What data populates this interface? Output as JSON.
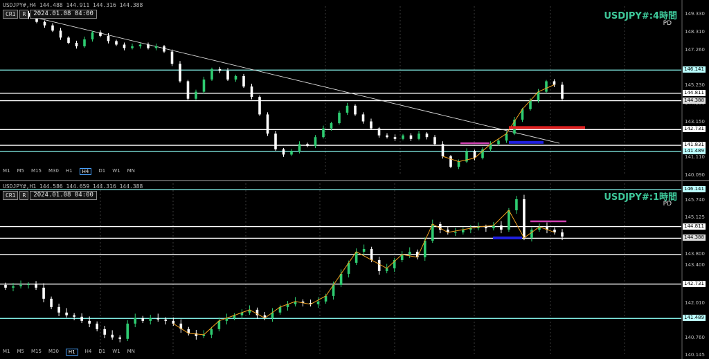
{
  "panes": [
    {
      "symbol_line": "USDJPY#,H4  144.488 144.911 144.316 144.388",
      "controls": {
        "cr": "CR1",
        "r": "R",
        "date": "2024.01.08 04:00"
      },
      "title": "USDJPY#:4時間",
      "subtitle": "PD",
      "timeframes": [
        "M1",
        "M5",
        "M15",
        "M30",
        "H1",
        "H4",
        "D1",
        "W1",
        "MN"
      ],
      "active_timeframe": "H4",
      "axis": {
        "min": 140.09,
        "max": 149.6,
        "ticks": [
          149.33,
          148.31,
          147.26,
          146.141,
          145.23,
          144.811,
          144.388,
          144.2,
          143.15,
          142.731,
          141.831,
          141.489,
          141.11,
          140.09
        ]
      },
      "tags": [
        {
          "value": 146.141,
          "text": "146.141",
          "style": "cyan"
        },
        {
          "value": 144.811,
          "text": "144.811",
          "style": "white"
        },
        {
          "value": 144.388,
          "text": "144.388",
          "style": "gray"
        },
        {
          "value": 142.731,
          "text": "142.731",
          "style": "white"
        },
        {
          "value": 141.831,
          "text": "141.831",
          "style": "white"
        },
        {
          "value": 141.489,
          "text": "141.489",
          "style": "cyan"
        }
      ]
    },
    {
      "symbol_line": "USDJPY#,H1  144.586 144.659 144.316 144.388",
      "controls": {
        "cr": "CR1",
        "r": "R",
        "date": "2024.01.08 04:00"
      },
      "title": "USDJPY#:1時間",
      "subtitle": "PD",
      "timeframes": [
        "M1",
        "M5",
        "M15",
        "M30",
        "H1",
        "H4",
        "D1",
        "W1",
        "MN"
      ],
      "active_timeframe": "H1",
      "axis": {
        "min": 140.145,
        "max": 146.25,
        "ticks": [
          146.141,
          145.74,
          145.125,
          144.811,
          144.388,
          143.8,
          143.4,
          142.731,
          142.01,
          141.489,
          140.76,
          140.145
        ]
      },
      "tags": [
        {
          "value": 146.141,
          "text": "146.141",
          "style": "cyan"
        },
        {
          "value": 144.811,
          "text": "144.811",
          "style": "white"
        },
        {
          "value": 144.388,
          "text": "144.388",
          "style": "gray"
        },
        {
          "value": 142.731,
          "text": "142.731",
          "style": "white"
        },
        {
          "value": 141.489,
          "text": "141.489",
          "style": "cyan"
        }
      ]
    }
  ],
  "colors": {
    "bull": "#2ecc71",
    "bear": "#ffffff",
    "cyan": "#7fe8e0",
    "white": "#ffffff",
    "orange": "#f0a020",
    "red": "#e02020",
    "blue": "#2020e0",
    "magenta": "#d040b0",
    "title": "#3ec89a"
  },
  "chart_data": [
    {
      "type": "candlestick",
      "series": [
        {
          "name": "USDJPY#:4時間",
          "close": [
            149.4,
            149.2,
            148.9,
            148.7,
            148.4,
            148.0,
            147.7,
            147.5,
            147.9,
            148.3,
            148.1,
            147.8,
            147.6,
            147.4,
            147.5,
            147.6,
            147.4,
            147.5,
            147.2,
            146.5,
            145.5,
            144.5,
            144.9,
            145.6,
            146.2,
            146.1,
            145.6,
            145.8,
            145.2,
            144.6,
            143.6,
            142.5,
            141.6,
            141.3,
            141.5,
            141.9,
            141.8,
            142.3,
            142.8,
            143.1,
            143.7,
            144.1,
            143.6,
            143.2,
            142.8,
            142.4,
            142.3,
            142.2,
            142.4,
            142.2,
            142.5,
            142.3,
            141.9,
            141.2,
            140.6,
            140.9,
            141.5,
            141.1,
            141.6,
            141.9,
            142.1,
            142.5,
            143.3,
            143.9,
            144.4,
            144.9,
            145.5,
            145.3,
            144.5
          ]
        }
      ],
      "hlines": [
        146.141,
        144.811,
        144.388,
        142.731,
        141.831,
        141.489
      ],
      "trendline": {
        "from": 149.35,
        "to": 141.95
      },
      "zones": [
        {
          "color": "red",
          "level": 142.85
        },
        {
          "color": "magenta",
          "level": 141.95
        },
        {
          "color": "blue",
          "level": 142.0
        }
      ]
    },
    {
      "type": "candlestick",
      "series": [
        {
          "name": "USDJPY#:1時間",
          "close": [
            142.6,
            142.65,
            142.7,
            142.72,
            142.6,
            142.2,
            141.9,
            141.7,
            141.6,
            141.55,
            141.4,
            141.3,
            141.1,
            140.9,
            140.8,
            140.75,
            141.3,
            141.5,
            141.4,
            141.5,
            141.45,
            141.4,
            141.3,
            141.1,
            140.95,
            140.85,
            140.9,
            141.1,
            141.4,
            141.5,
            141.6,
            141.7,
            141.8,
            141.6,
            141.5,
            141.7,
            141.9,
            142.0,
            142.1,
            142.05,
            142.0,
            142.1,
            142.3,
            142.7,
            143.1,
            143.5,
            143.9,
            144.0,
            143.6,
            143.2,
            143.3,
            143.6,
            143.8,
            143.9,
            143.7,
            144.3,
            144.9,
            144.7,
            144.6,
            144.6,
            144.7,
            144.75,
            144.8,
            144.75,
            144.85,
            144.7,
            145.4,
            145.8,
            144.4,
            144.7,
            144.8,
            144.7,
            144.6,
            144.45
          ]
        }
      ],
      "hlines": [
        146.141,
        144.811,
        144.388,
        143.8,
        142.731,
        141.489
      ],
      "zones": [
        {
          "color": "magenta",
          "level": 145.0
        },
        {
          "color": "blue",
          "level": 144.4
        }
      ]
    }
  ]
}
